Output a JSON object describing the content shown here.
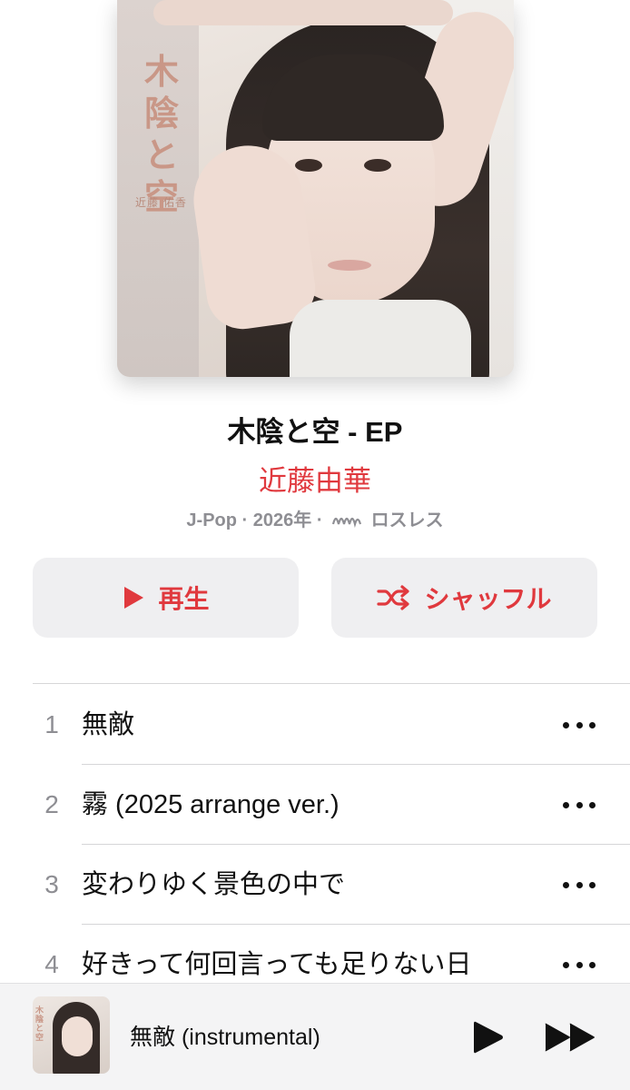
{
  "album": {
    "artwork_title": "木陰と空",
    "artwork_artist": "近藤 佑香",
    "title": "木陰と空 - EP",
    "artist": "近藤由華",
    "genre": "J-Pop",
    "year": "2026年",
    "lossless_label": "ロスレス"
  },
  "actions": {
    "play_label": "再生",
    "shuffle_label": "シャッフル"
  },
  "tracks": [
    {
      "number": "1",
      "title": "無敵"
    },
    {
      "number": "2",
      "title": "霧 (2025 arrange ver.)"
    },
    {
      "number": "3",
      "title": "変わりゆく景色の中で"
    },
    {
      "number": "4",
      "title": "好きって何回言っても足りない日"
    }
  ],
  "now_playing": {
    "title": "無敵 (instrumental)",
    "artwork_title": "木陰と空"
  },
  "colors": {
    "accent": "#e0393e",
    "secondary_text": "#8e8e93",
    "button_bg": "#efeff1"
  }
}
